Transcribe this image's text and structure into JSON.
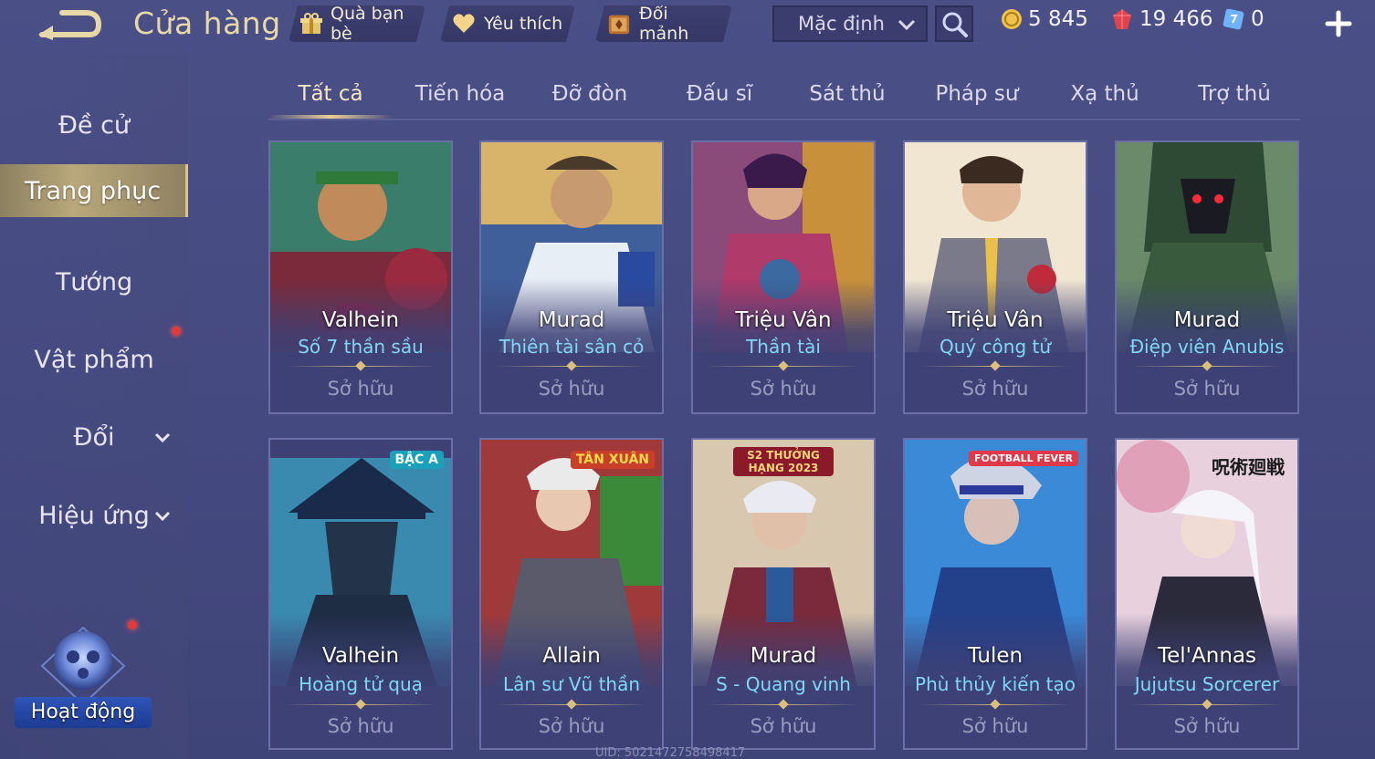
{
  "header": {
    "title": "Cửa hàng",
    "buttons": {
      "gift": "Quà bạn bè",
      "favorite": "Yêu thích",
      "exchange": "Đổi mảnh"
    },
    "sort": {
      "selected": "Mặc định"
    },
    "currencies": {
      "gold": "5 845",
      "ruby": "19 466",
      "voucher": "0"
    }
  },
  "sidebar": {
    "items": [
      {
        "label": "Đề cử"
      },
      {
        "label": "Trang phục"
      },
      {
        "label": "Tướng"
      },
      {
        "label": "Vật phẩm"
      },
      {
        "label": "Đổi"
      },
      {
        "label": "Hiệu ứng"
      }
    ],
    "event_label": "Hoạt động"
  },
  "tabs": [
    {
      "label": "Tất cả"
    },
    {
      "label": "Tiến hóa"
    },
    {
      "label": "Đỡ đòn"
    },
    {
      "label": "Đấu sĩ"
    },
    {
      "label": "Sát thủ"
    },
    {
      "label": "Pháp sư"
    },
    {
      "label": "Xạ thủ"
    },
    {
      "label": "Trợ thủ"
    }
  ],
  "cards": [
    {
      "hero": "Valhein",
      "skin": "Số 7 thần sầu",
      "status": "Sở hữu"
    },
    {
      "hero": "Murad",
      "skin": "Thiên tài sân cỏ",
      "status": "Sở hữu"
    },
    {
      "hero": "Triệu Vân",
      "skin": "Thần tài",
      "status": "Sở hữu"
    },
    {
      "hero": "Triệu Vân",
      "skin": "Quý công tử",
      "status": "Sở hữu"
    },
    {
      "hero": "Murad",
      "skin": "Điệp viên Anubis",
      "status": "Sở hữu"
    },
    {
      "hero": "Valhein",
      "skin": "Hoàng tử quạ",
      "status": "Sở hữu",
      "badge": "BẬC A"
    },
    {
      "hero": "Allain",
      "skin": "Lân sư Vũ thần",
      "status": "Sở hữu",
      "badge": "TÂN XUÂN"
    },
    {
      "hero": "Murad",
      "skin": "S - Quang vinh",
      "status": "Sở hữu",
      "badge": "S2 THƯỞNG HẠNG 2023"
    },
    {
      "hero": "Tulen",
      "skin": "Phù thủy kiến tạo",
      "status": "Sở hữu",
      "badge": "FOOTBALL FEVER"
    },
    {
      "hero": "Tel'Annas",
      "skin": "Jujutsu Sorcerer",
      "status": "Sở hữu",
      "badge": "呪術廻戦"
    }
  ],
  "uid": "UID: 5021472758498417",
  "colors": {
    "accent_gold": "#e9cf8f",
    "skin_name": "#7fd8f5",
    "background": "#464b82"
  }
}
